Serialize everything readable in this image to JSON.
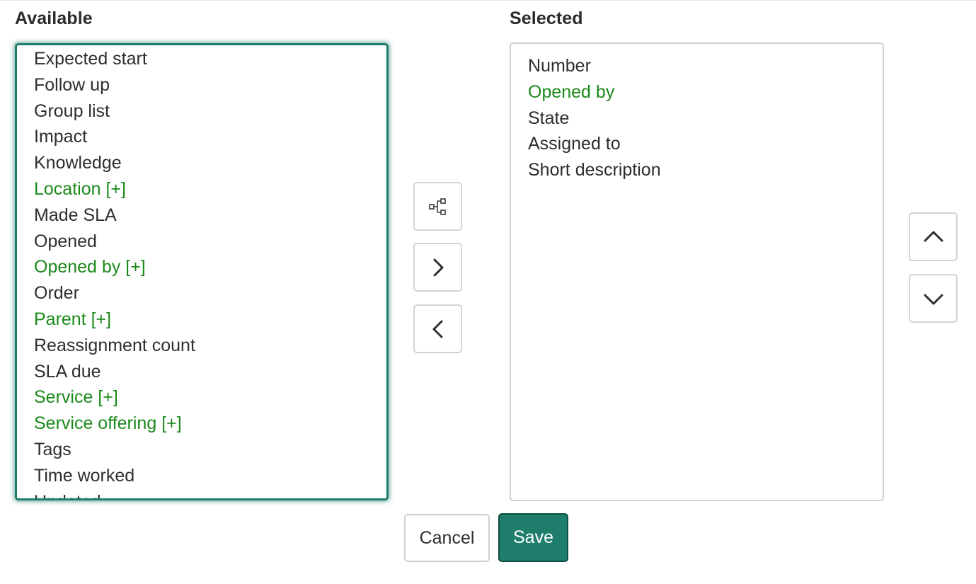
{
  "available": {
    "label": "Available",
    "items": [
      {
        "label": "Expected start",
        "reference": false
      },
      {
        "label": "Follow up",
        "reference": false
      },
      {
        "label": "Group list",
        "reference": false
      },
      {
        "label": "Impact",
        "reference": false
      },
      {
        "label": "Knowledge",
        "reference": false
      },
      {
        "label": "Location [+]",
        "reference": true
      },
      {
        "label": "Made SLA",
        "reference": false
      },
      {
        "label": "Opened",
        "reference": false
      },
      {
        "label": "Opened by [+]",
        "reference": true
      },
      {
        "label": "Order",
        "reference": false
      },
      {
        "label": "Parent [+]",
        "reference": true
      },
      {
        "label": "Reassignment count",
        "reference": false
      },
      {
        "label": "SLA due",
        "reference": false
      },
      {
        "label": "Service [+]",
        "reference": true
      },
      {
        "label": "Service offering [+]",
        "reference": true
      },
      {
        "label": "Tags",
        "reference": false
      },
      {
        "label": "Time worked",
        "reference": false
      },
      {
        "label": "Updated",
        "reference": false
      }
    ]
  },
  "selected": {
    "label": "Selected",
    "items": [
      {
        "label": "Number",
        "reference": false
      },
      {
        "label": "Opened by",
        "reference": true
      },
      {
        "label": "State",
        "reference": false
      },
      {
        "label": "Assigned to",
        "reference": false
      },
      {
        "label": "Short description",
        "reference": false
      }
    ]
  },
  "transfer_buttons": [
    {
      "icon": "dot-walk-icon"
    },
    {
      "icon": "chevron-right-icon"
    },
    {
      "icon": "chevron-left-icon"
    }
  ],
  "order_buttons": [
    {
      "icon": "chevron-up-icon"
    },
    {
      "icon": "chevron-down-icon"
    }
  ],
  "footer": {
    "cancel_label": "Cancel",
    "save_label": "Save"
  },
  "colors": {
    "accent": "#1f7d6c",
    "reference_text": "#1a8a1a",
    "text": "#2e2e2e"
  }
}
